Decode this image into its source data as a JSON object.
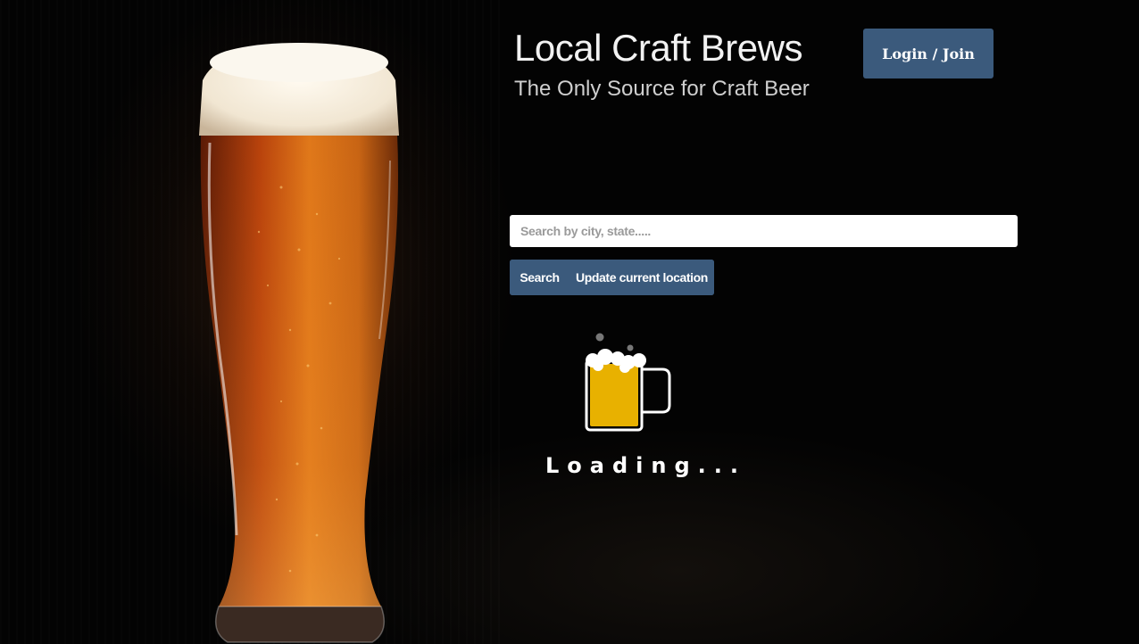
{
  "header": {
    "title": "Local Craft Brews",
    "subtitle": "The Only Source for Craft Beer",
    "login_label": "Login / Join"
  },
  "search": {
    "value": "",
    "placeholder": "Search by city, state.....",
    "search_label": "Search",
    "location_label": "Update current location"
  },
  "loader": {
    "icon": "beer-mug-icon",
    "text": "Loading..."
  },
  "hero": {
    "image": "beer-glass-image"
  },
  "colors": {
    "accent": "#3b5a7c",
    "beer": "#e8b100",
    "background": "#030303"
  }
}
